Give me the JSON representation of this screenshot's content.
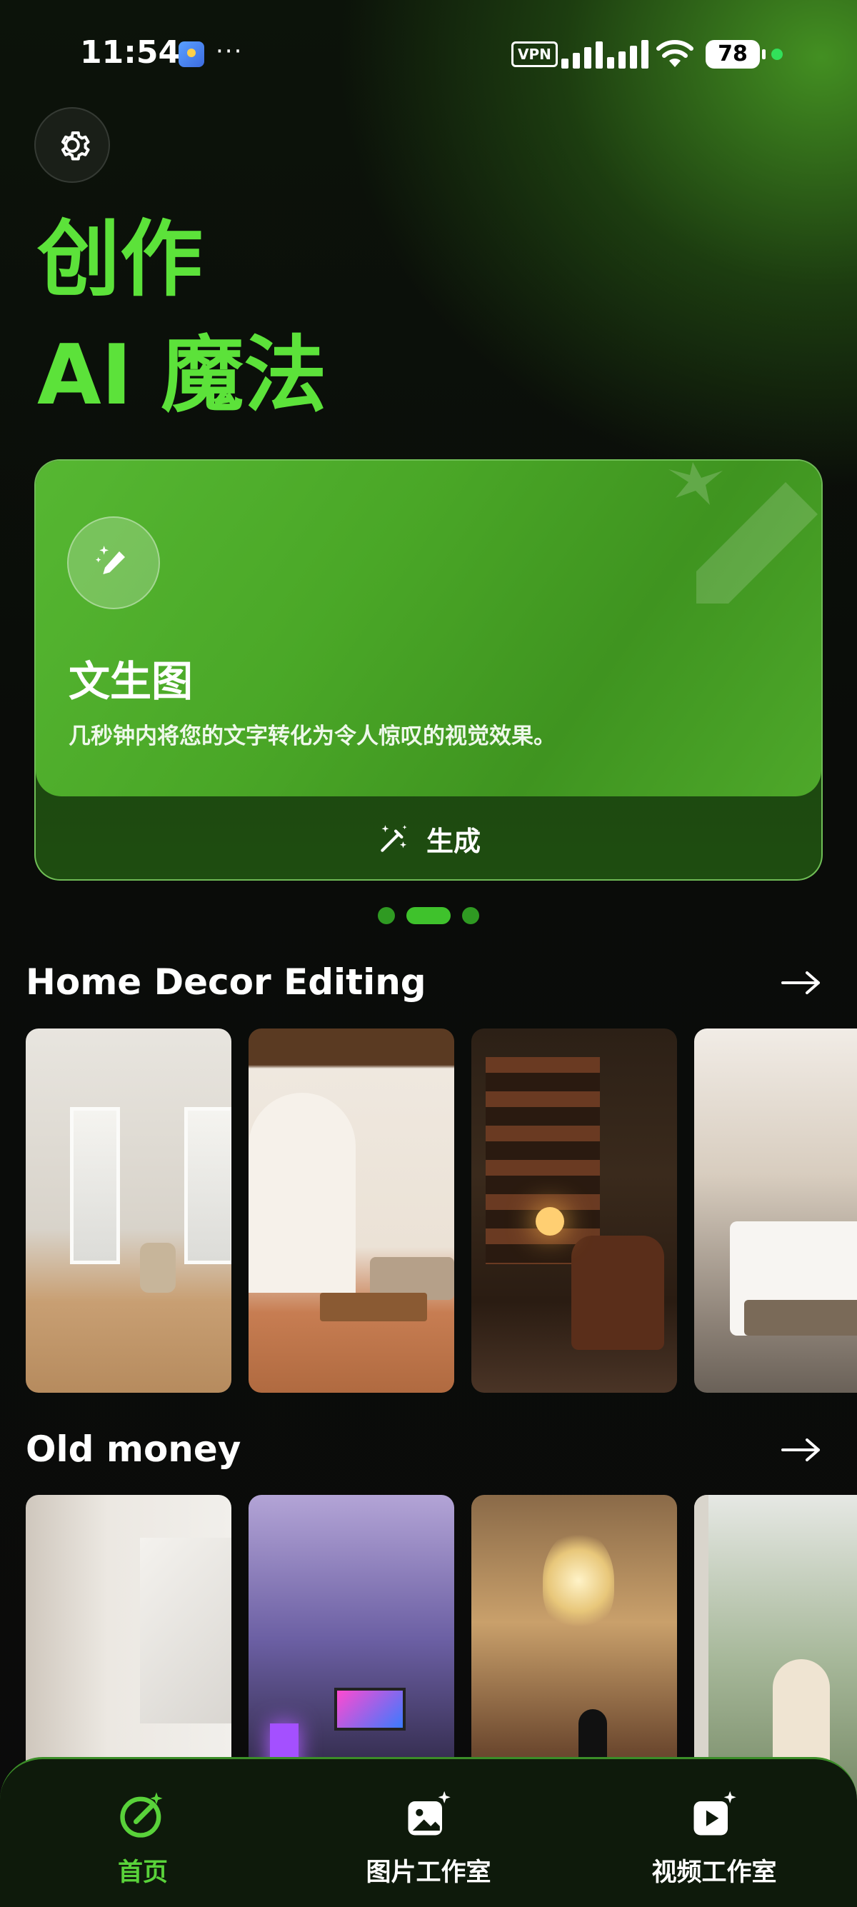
{
  "status_bar": {
    "time": "11:54",
    "dots": "···",
    "vpn": "VPN",
    "battery": "78"
  },
  "header": {
    "settings_icon": "gear-icon"
  },
  "hero": {
    "line1": "创作",
    "line2": "AI 魔法"
  },
  "feature_card": {
    "icon": "magic-pen-icon",
    "title": "文生图",
    "description": "几秒钟内将您的文字转化为令人惊叹的视觉效果。",
    "button_label": "生成",
    "button_icon": "magic-wand-icon"
  },
  "carousel": {
    "count": 3,
    "active_index": 1
  },
  "sections": [
    {
      "title": "Home Decor Editing",
      "arrow_icon": "arrow-right-icon",
      "images": [
        "classic-white-room",
        "mediterranean-living-room",
        "library-study",
        "hotel-bedroom"
      ]
    },
    {
      "title": "Old money",
      "arrow_icon": "arrow-right-icon",
      "images": [
        "marble-tv-wall",
        "gaming-room",
        "ballroom-chandelier",
        "woman-by-window"
      ]
    }
  ],
  "bottom_nav": {
    "items": [
      {
        "label": "首页",
        "icon": "home-create-icon",
        "active": true
      },
      {
        "label": "图片工作室",
        "icon": "image-studio-icon",
        "active": false
      },
      {
        "label": "视频工作室",
        "icon": "video-studio-icon",
        "active": false
      }
    ]
  },
  "colors": {
    "accent": "#5ce23a",
    "card_green": "#4aa727",
    "background": "#0b0b0b"
  }
}
